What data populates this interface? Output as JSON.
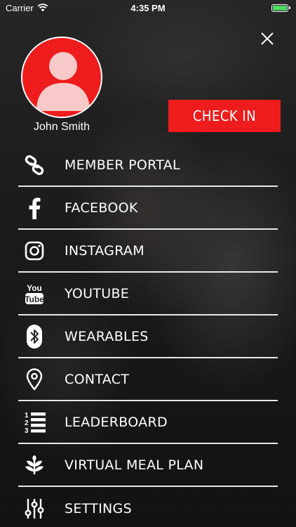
{
  "status_bar": {
    "carrier": "Carrier",
    "time": "4:35 PM"
  },
  "profile": {
    "name": "John Smith"
  },
  "check_in": {
    "label": "CHECK IN"
  },
  "menu": {
    "items": [
      {
        "label": "MEMBER PORTAL",
        "icon": "link-icon"
      },
      {
        "label": "FACEBOOK",
        "icon": "facebook-icon"
      },
      {
        "label": "INSTAGRAM",
        "icon": "instagram-icon"
      },
      {
        "label": "YOUTUBE",
        "icon": "youtube-icon"
      },
      {
        "label": "WEARABLES",
        "icon": "bluetooth-icon"
      },
      {
        "label": "CONTACT",
        "icon": "location-pin-icon"
      },
      {
        "label": "LEADERBOARD",
        "icon": "numbered-list-icon"
      },
      {
        "label": "VIRTUAL MEAL PLAN",
        "icon": "leaf-icon"
      },
      {
        "label": "SETTINGS",
        "icon": "sliders-icon"
      }
    ]
  },
  "youtube_icon_text": {
    "top": "You",
    "bottom": "Tube"
  },
  "colors": {
    "accent": "#ee1c1c",
    "avatar_silhouette": "#f7c9c9",
    "battery": "#4cd964",
    "divider": "#e8e8e8"
  }
}
